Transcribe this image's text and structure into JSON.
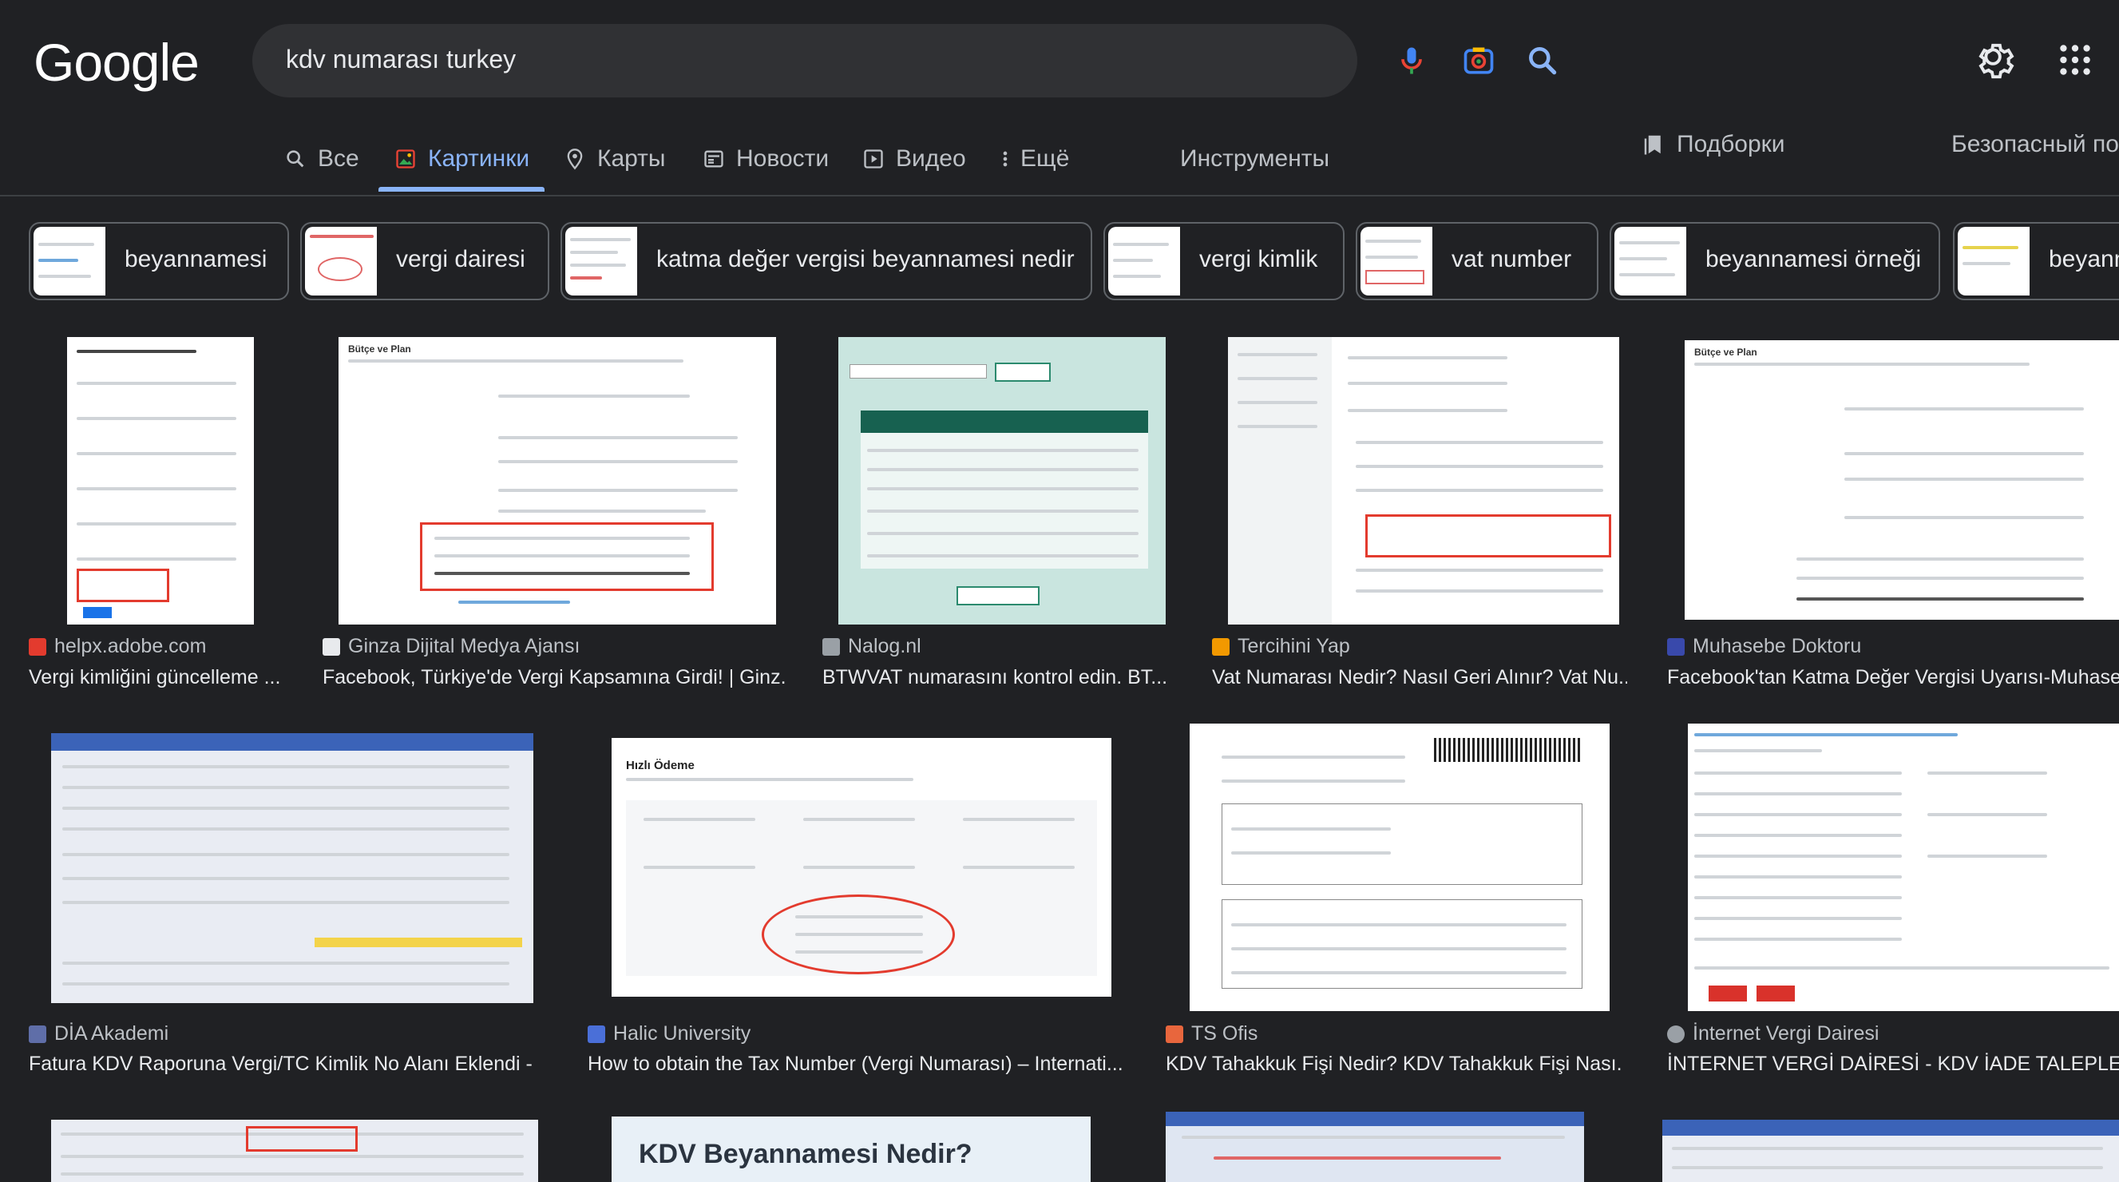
{
  "header": {
    "logo": "Google",
    "search_query": "kdv numarası turkey"
  },
  "tabs": [
    {
      "label": "Все"
    },
    {
      "label": "Картинки"
    },
    {
      "label": "Карты"
    },
    {
      "label": "Новости"
    },
    {
      "label": "Видео"
    },
    {
      "label": "Ещё"
    },
    {
      "label": "Инструменты"
    }
  ],
  "right_links": {
    "collections": "Подборки",
    "safe_search": "Безопасный поиск"
  },
  "chips": [
    {
      "label": "beyannamesi"
    },
    {
      "label": "vergi dairesi"
    },
    {
      "label": "katma değer vergisi beyannamesi nedir"
    },
    {
      "label": "vergi kimlik"
    },
    {
      "label": "vat number"
    },
    {
      "label": "beyannamesi örneği"
    },
    {
      "label": "beyann"
    }
  ],
  "results": [
    {
      "source": "helpx.adobe.com",
      "title": "Vergi kimliğini güncelleme ...",
      "favicon_color": "#e33b2e"
    },
    {
      "source": "Ginza Dijital Medya Ajansı",
      "title": "Facebook, Türkiye'de Vergi Kapsamına Girdi! | Ginz...",
      "favicon_color": "#e8eaed"
    },
    {
      "source": "Nalog.nl",
      "title": "BTWVAT numarasını kontrol edin. BT...",
      "favicon_color": "#9aa0a6"
    },
    {
      "source": "Tercihini Yap",
      "title": "Vat Numarası Nedir? Nasıl Geri Alınır? Vat Nu...",
      "favicon_color": "#f29900"
    },
    {
      "source": "Muhasebe Doktoru",
      "title": "Facebook'tan Katma Değer Vergisi Uyarısı-Muhaseb",
      "favicon_color": "#3949ab"
    },
    {
      "source": "DİA Akademi",
      "title": "Fatura KDV Raporuna Vergi/TC Kimlik No Alanı Eklendi - ...",
      "favicon_color": "#5f6ea8"
    },
    {
      "source": "Halic University",
      "title": "How to obtain the Tax Number (Vergi Numarası) – Internati...",
      "favicon_color": "#4a6fd8"
    },
    {
      "source": "TS Ofis",
      "title": "KDV Tahakkuk Fişi Nedir? KDV Tahakkuk Fişi Nası...",
      "favicon_color": "#e8663d"
    },
    {
      "source": "İnternet Vergi Dairesi",
      "title": "İNTERNET VERGİ DAİRESİ - KDV İADE TALEPLERİNE",
      "favicon_color": "#9aa0a6"
    }
  ],
  "thumb_texts": {
    "kdv_beyannamesi": "KDV Beyannamesi Nedir?",
    "hizli_odeme": "Hızlı Ödeme",
    "butce_plan": "Bütçe ve Plan"
  }
}
